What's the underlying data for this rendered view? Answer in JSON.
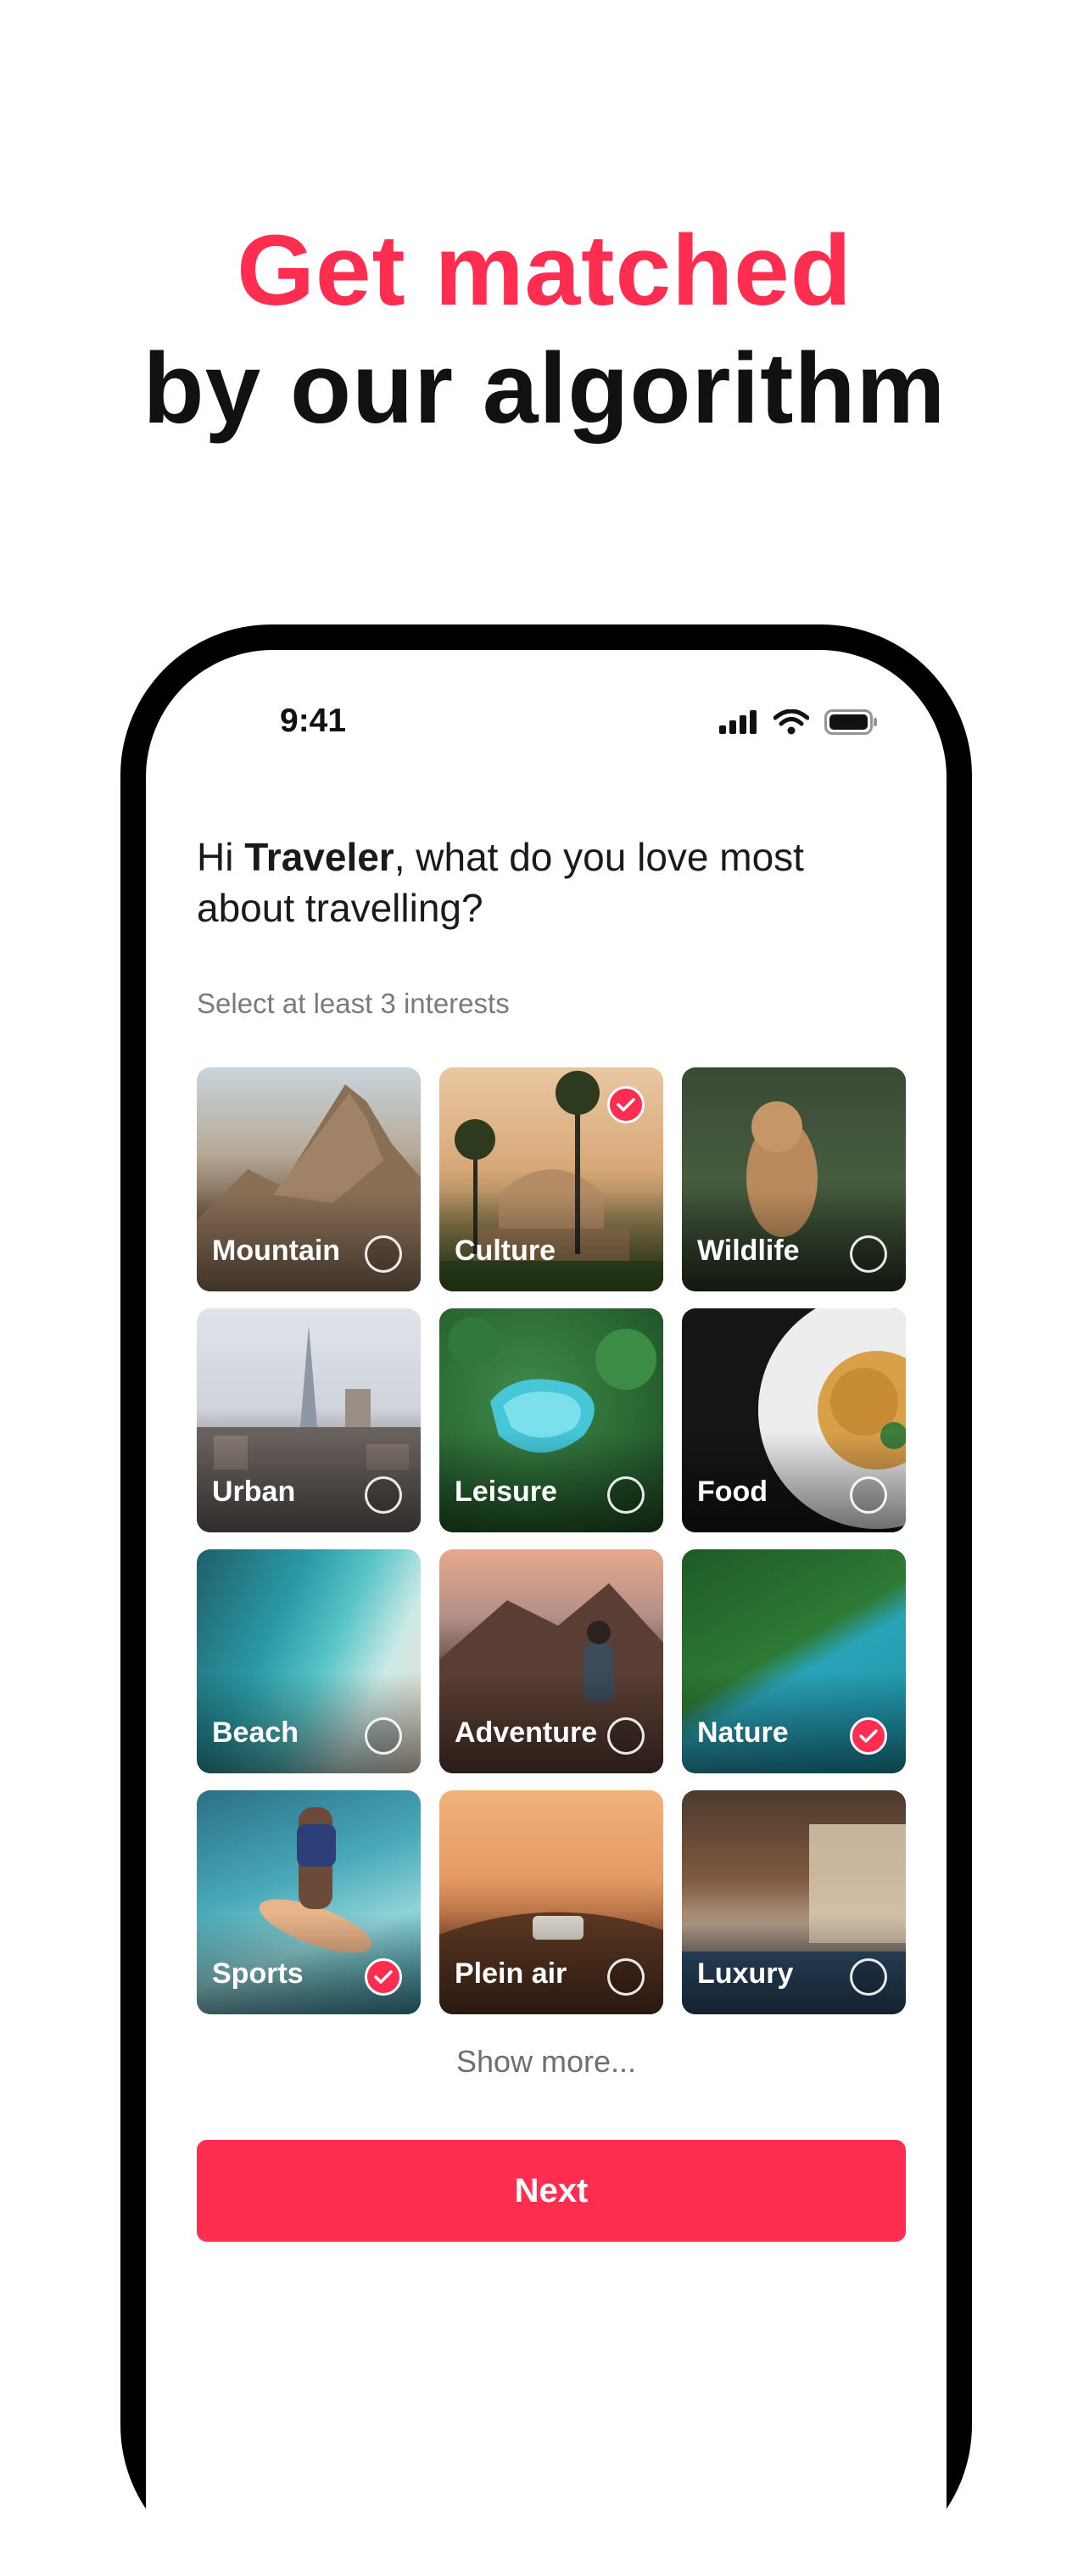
{
  "headline": {
    "line1": "Get matched",
    "line2": "by our algorithm"
  },
  "colors": {
    "accent": "#ff2d4f",
    "text": "#111111"
  },
  "status_bar": {
    "time": "9:41",
    "icons": [
      "cellular-signal-icon",
      "wifi-icon",
      "battery-icon"
    ]
  },
  "greeting": {
    "prefix": "Hi ",
    "name": "Traveler",
    "suffix": ", what do you love most about travelling?"
  },
  "hint": "Select at least 3 interests",
  "interests": [
    {
      "label": "Mountain",
      "selected": false
    },
    {
      "label": "Culture",
      "selected": true
    },
    {
      "label": "Wildlife",
      "selected": false
    },
    {
      "label": "Urban",
      "selected": false
    },
    {
      "label": "Leisure",
      "selected": false
    },
    {
      "label": "Food",
      "selected": false
    },
    {
      "label": "Beach",
      "selected": false
    },
    {
      "label": "Adventure",
      "selected": false
    },
    {
      "label": "Nature",
      "selected": true
    },
    {
      "label": "Sports",
      "selected": true
    },
    {
      "label": "Plein air",
      "selected": false
    },
    {
      "label": "Luxury",
      "selected": false
    }
  ],
  "show_more": "Show more...",
  "next_label": "Next"
}
